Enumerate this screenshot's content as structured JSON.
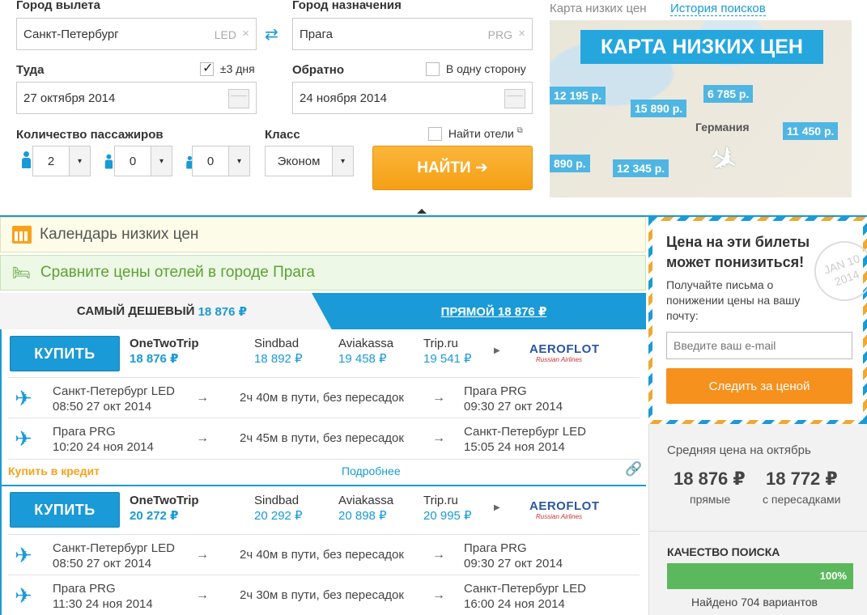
{
  "search": {
    "from_label": "Город вылета",
    "from_value": "Санкт-Петербург",
    "from_code": "LED",
    "to_label": "Город назначения",
    "to_value": "Прага",
    "to_code": "PRG",
    "depart_label": "Туда",
    "flex_label": "±3 дня",
    "depart_value": "27 октября 2014",
    "return_label": "Обратно",
    "oneway_label": "В одну сторону",
    "return_value": "24 ноября 2014",
    "pax_label": "Количество пассажиров",
    "adults": "2",
    "children": "0",
    "infants": "0",
    "class_label": "Класс",
    "class_value": "Эконом",
    "hotels_label": "Найти отели",
    "find_button": "НАЙТИ ➔"
  },
  "map": {
    "tab_map": "Карта низких цен",
    "tab_history": "История поисков",
    "title": "КАРТА НИЗКИХ ЦЕН",
    "prices": [
      "12 195 р.",
      "15 890 р.",
      "6 785 р.",
      "11 450 р.",
      "890 р.",
      "12 345 р."
    ],
    "country": "Германия"
  },
  "banners": {
    "calendar": "Календарь низких цен",
    "hotels": "Сравните цены отелей в городе Прага"
  },
  "tabs": {
    "cheapest_label": "САМЫЙ ДЕШЕВЫЙ",
    "cheapest_price": "18 876 ₽",
    "direct_label": "ПРЯМОЙ 18 876 ₽"
  },
  "results": [
    {
      "buy": "КУПИТЬ",
      "agents": [
        {
          "name": "OneTwoTrip",
          "price": "18 876 ₽"
        },
        {
          "name": "Sindbad",
          "price": "18 892 ₽"
        },
        {
          "name": "Aviakassa",
          "price": "19 458 ₽"
        },
        {
          "name": "Trip.ru",
          "price": "19 541 ₽"
        }
      ],
      "airline": "AEROFLOT",
      "airline_sub": "Russian Airlines",
      "segments": [
        {
          "from_city": "Санкт-Петербург LED",
          "from_time": "08:50 27 окт 2014",
          "duration": "2ч 40м в пути, без пересадок",
          "to_city": "Прага PRG",
          "to_time": "09:30 27 окт 2014"
        },
        {
          "from_city": "Прага PRG",
          "from_time": "10:20 24 ноя 2014",
          "duration": "2ч 45м в пути, без пересадок",
          "to_city": "Санкт-Петербург LED",
          "to_time": "15:05 24 ноя 2014"
        }
      ],
      "credit": "Купить в кредит",
      "details": "Подробнее"
    },
    {
      "buy": "КУПИТЬ",
      "agents": [
        {
          "name": "OneTwoTrip",
          "price": "20 272 ₽"
        },
        {
          "name": "Sindbad",
          "price": "20 292 ₽"
        },
        {
          "name": "Aviakassa",
          "price": "20 898 ₽"
        },
        {
          "name": "Trip.ru",
          "price": "20 995 ₽"
        }
      ],
      "airline": "AEROFLOT",
      "airline_sub": "Russian Airlines",
      "segments": [
        {
          "from_city": "Санкт-Петербург LED",
          "from_time": "08:50 27 окт 2014",
          "duration": "2ч 40м в пути, без пересадок",
          "to_city": "Прага PRG",
          "to_time": "09:30 27 окт 2014"
        },
        {
          "from_city": "Прага PRG",
          "from_time": "11:30 24 ноя 2014",
          "duration": "2ч 30м в пути, без пересадок",
          "to_city": "Санкт-Петербург LED",
          "to_time": "16:00 24 ноя 2014"
        }
      ]
    }
  ],
  "sidebar": {
    "subscribe_title": "Цена на эти билеты может понизиться!",
    "subscribe_text": "Получайте письма о понижении цены на вашу почту:",
    "email_placeholder": "Введите ваш e-mail",
    "follow_button": "Следить за ценой",
    "stamp_text": "JAN 10 2014",
    "avg_label": "Средняя цена на октябрь",
    "direct_price": "18 876 ₽",
    "direct_label": "прямые",
    "transfer_price": "18 772 ₽",
    "transfer_label": "с пересадками",
    "quality_label": "КАЧЕСТВО ПОИСКА",
    "quality_percent": "100%",
    "found_text": "Найдено 704 вариантов"
  },
  "colors": {
    "accent": "#1a9ad6",
    "orange": "#f7a21b",
    "green": "#5cb85c"
  }
}
